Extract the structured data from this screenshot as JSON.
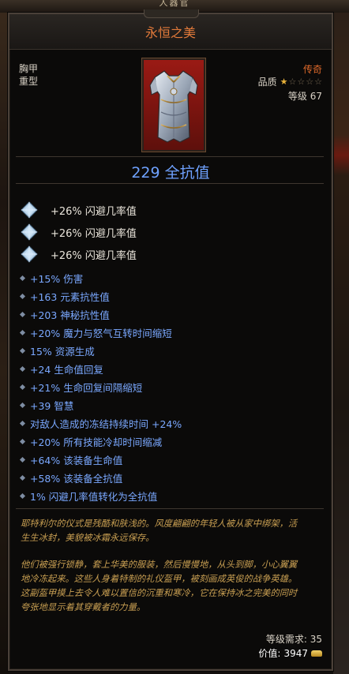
{
  "window": {
    "top_tab_text": "人器官"
  },
  "item": {
    "name": "永恒之美",
    "slot": "胸甲",
    "weight_class": "重型",
    "rarity": "传奇",
    "quality_label": "品质",
    "quality_stars": 1,
    "quality_stars_max": 5,
    "level_label": "等级",
    "level_value": "67",
    "level_text": "等级 67",
    "primary_stat": "229 全抗值",
    "gems": [
      {
        "text": "+26% 闪避几率值",
        "icon": "diamond-gem-icon"
      },
      {
        "text": "+26% 闪避几率值",
        "icon": "diamond-gem-icon"
      },
      {
        "text": "+26% 闪避几率值",
        "icon": "diamond-gem-icon"
      }
    ],
    "affixes": [
      "+15% 伤害",
      "+163 元素抗性值",
      "+203 神秘抗性值",
      "+20% 魔力与怒气互转时间缩短",
      "15% 资源生成",
      "+24 生命值回复",
      "+21% 生命回复间隔缩短",
      "+39 智慧",
      "对敌人造成的冻结持续时间 +24%",
      "+20% 所有技能冷却时间缩减",
      "+64% 该装备生命值",
      "+58% 该装备全抗值",
      "1% 闪避几率值转化为全抗值"
    ],
    "flavor_lines": [
      "耶特利尔的仪式是残酷和肤浅的。风度翩翩的年轻人被从家中绑架，活",
      "生生冰封，美貌被冰霜永远保存。",
      "",
      "他们被强行锁静，套上华美的服装，然后慢慢地，从头到脚，小心翼翼",
      "地冷冻起来。这些人身着特制的礼仪盔甲，被刻画成英俊的战争英雄。",
      "这副盔甲摸上去令人难以置信的沉重和寒冷，它在保持冰之完美的同时",
      "夸张地显示着其穿戴者的力量。"
    ],
    "requirement_text": "等级需求: 35",
    "price_label": "价值:",
    "price_value": "3947"
  },
  "colors": {
    "title": "#e27a3a",
    "rarity": "#e06a2a",
    "affix": "#7aa8ff",
    "primary_stat": "#6fa2ff",
    "flavor": "#c89f52",
    "star_on": "#e8b23a"
  }
}
